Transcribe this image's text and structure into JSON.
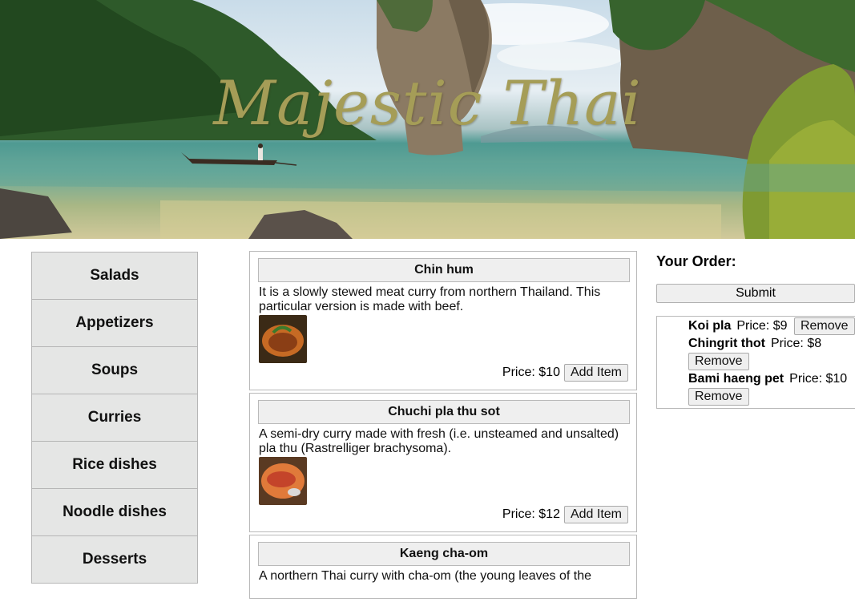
{
  "banner": {
    "title": "Majestic Thai"
  },
  "categories": [
    {
      "label": "Salads"
    },
    {
      "label": "Appetizers"
    },
    {
      "label": "Soups"
    },
    {
      "label": "Curries"
    },
    {
      "label": "Rice dishes"
    },
    {
      "label": "Noodle dishes"
    },
    {
      "label": "Desserts"
    }
  ],
  "menu": [
    {
      "name": "Chin hum",
      "description": "It is a slowly stewed meat curry from northern Thailand. This particular version is made with beef.",
      "price": "Price: $10",
      "add_label": "Add Item",
      "colors": [
        "#5b3a1c",
        "#c66a24"
      ]
    },
    {
      "name": "Chuchi pla thu sot",
      "description": "A semi-dry curry made with fresh (i.e. unsteamed and unsalted) pla thu (Rastrelliger brachysoma).",
      "price": "Price: $12",
      "add_label": "Add Item",
      "colors": [
        "#7a4a2a",
        "#d0552a"
      ]
    },
    {
      "name": "Kaeng cha-om",
      "description": "A northern Thai curry with cha-om (the young leaves of the",
      "price": "",
      "add_label": "",
      "colors": [
        "#6a5a2a",
        "#9a8a3a"
      ]
    }
  ],
  "order": {
    "title": "Your Order:",
    "submit_label": "Submit",
    "remove_label": "Remove",
    "items": [
      {
        "name": "Koi pla",
        "price": "Price: $9"
      },
      {
        "name": "Chingrit thot",
        "price": "Price: $8"
      },
      {
        "name": "Bami haeng pet",
        "price": "Price: $10"
      }
    ]
  }
}
